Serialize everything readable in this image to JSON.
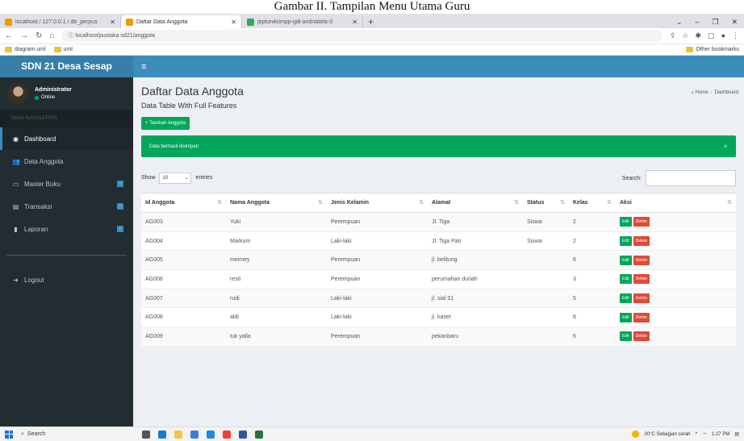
{
  "caption": "Gambar II. Tampilan Menu Utama Guru",
  "browser": {
    "tabs": [
      {
        "label": "localhost / 127.0.0.1 / db_perpus",
        "color": "#f29900",
        "active": false
      },
      {
        "label": "Daftar Data Anggota",
        "color": "#f29900",
        "active": true
      },
      {
        "label": "jbptunikompp-gdl-andriatafa-3",
        "color": "#34a853",
        "active": false
      }
    ],
    "url": "localhost/pustaka sd21/anggota",
    "bookmarks": [
      "diagram uml",
      "uml"
    ],
    "other_bookmarks": "Other bookmarks"
  },
  "sidebar": {
    "brand": "SDN 21 Desa Sesap",
    "user_name": "Administrator",
    "user_status": "Online",
    "nav_header": "MAIN NAVIGATION",
    "items": [
      {
        "label": "Dashboard",
        "icon": "dashboard-icon"
      },
      {
        "label": "Data Anggota",
        "icon": "users-icon"
      },
      {
        "label": "Master Buku",
        "icon": "laptop-icon"
      },
      {
        "label": "Transaksi",
        "icon": "chart-icon"
      },
      {
        "label": "Laporan",
        "icon": "book-icon"
      }
    ],
    "logout": "Logout"
  },
  "content": {
    "title": "Daftar Data Anggota",
    "breadcrumb": [
      "Home",
      "Dashboard"
    ],
    "subtitle": "Data Table With Full Features",
    "add_button": "+ Tambah Anggota",
    "alert": "Data berhasil disimpan",
    "show_label": "Show",
    "show_value": "10",
    "entries_label": "entries",
    "search_label": "Search:"
  },
  "table": {
    "headers": [
      "Id Anggota",
      "Nama Anggota",
      "Jenis Kelamin",
      "Alamat",
      "Status",
      "Kelas",
      "Aksi"
    ],
    "rows": [
      [
        "AG003",
        "Yuki",
        "Perempuan",
        "Jl. Tiga",
        "Siswa",
        "2"
      ],
      [
        "AG004",
        "Markum",
        "Laki-laki",
        "Jl. Tiga Pati",
        "Siswa",
        "2"
      ],
      [
        "AG005",
        "meimey",
        "Perempuan",
        "jl. belitung",
        "",
        "6"
      ],
      [
        "AG006",
        "resti",
        "Perempuan",
        "perumahan duriah",
        "",
        "3"
      ],
      [
        "AG007",
        "rudi",
        "Laki-laki",
        "jl. sial 01",
        "",
        "5"
      ],
      [
        "AG008",
        "aldi",
        "Laki-laki",
        "jl. kaset",
        "",
        "6"
      ],
      [
        "AG009",
        "tuk yalla",
        "Perempuan",
        "pekanbaru",
        "",
        "6"
      ]
    ],
    "edit_label": "Edit",
    "delete_label": "Delete"
  },
  "taskbar": {
    "search": "Search",
    "weather": "30°C Sebagian cerah",
    "time": "1:27 PM"
  }
}
